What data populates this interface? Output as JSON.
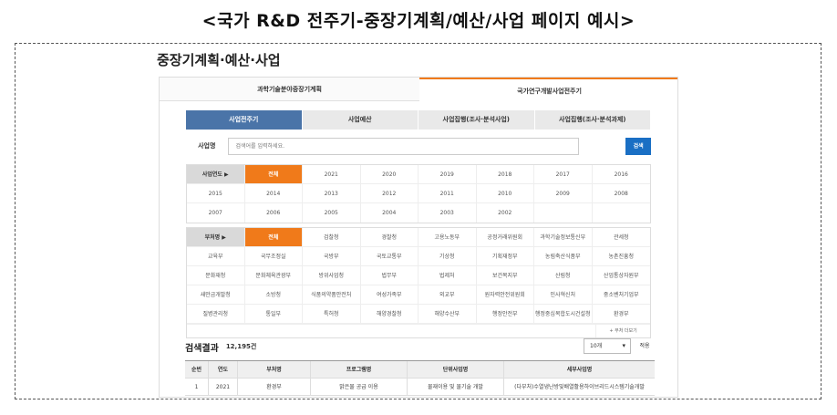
{
  "caption": "<국가 R&D 전주기-중장기계획/예산/사업 페이지 예시>",
  "page_title": "중장기계획·예산·사업",
  "top_tabs": [
    {
      "label": "과학기술분야중장기계획",
      "active": false
    },
    {
      "label": "국가연구개발사업전주기",
      "active": true
    }
  ],
  "sub_tabs": [
    {
      "label": "사업전주기",
      "active": true
    },
    {
      "label": "사업예산",
      "active": false
    },
    {
      "label": "사업집행(조사·분석사업)",
      "active": false
    },
    {
      "label": "사업집행(조사·분석과제)",
      "active": false
    }
  ],
  "search": {
    "label": "사업명",
    "placeholder": "검색어를 입력하세요.",
    "button": "검색"
  },
  "year_filter": {
    "header": "사업연도 ▶",
    "rows": [
      [
        "전체",
        "2021",
        "2020",
        "2019",
        "2018",
        "2017",
        "2016"
      ],
      [
        "2015",
        "2014",
        "2013",
        "2012",
        "2011",
        "2010",
        "2009",
        "2008"
      ],
      [
        "2007",
        "2006",
        "2005",
        "2004",
        "2003",
        "2002",
        "",
        ""
      ]
    ]
  },
  "ministry_filter": {
    "header": "부처명 ▶",
    "rows": [
      [
        "전체",
        "검찰청",
        "경찰청",
        "고용노동부",
        "공정거래위원회",
        "과학기술정보통신부",
        "관세청"
      ],
      [
        "교육부",
        "국무조정실",
        "국방부",
        "국토교통부",
        "기상청",
        "기획재정부",
        "농림축산식품부",
        "농촌진흥청"
      ],
      [
        "문화재청",
        "문화체육관광부",
        "방위사업청",
        "법무부",
        "법제처",
        "보건복지부",
        "산림청",
        "산업통상자원부"
      ],
      [
        "새만금개발청",
        "소방청",
        "식품의약품안전처",
        "여성가족부",
        "외교부",
        "원자력안전위원회",
        "인사혁신처",
        "중소벤처기업부"
      ],
      [
        "질병관리청",
        "통일부",
        "특허청",
        "해양경찰청",
        "해양수산부",
        "행정안전부",
        "행정중심복합도시건설청",
        "환경부"
      ]
    ],
    "more": "+ 부처 더보기"
  },
  "results": {
    "label": "검색결과",
    "count": "12,195건",
    "page_size": "10개",
    "apply": "적용"
  },
  "table": {
    "headers": [
      "순번",
      "연도",
      "부처명",
      "프로그램명",
      "단위사업명",
      "세부사업명"
    ],
    "rows": [
      [
        "1",
        "2021",
        "환경부",
        "맑은물 공급 이용",
        "물재이용 및 물기술 개발",
        "(다부처)수열냉난방및배열활용하이브리드시스템기술개발"
      ]
    ]
  },
  "colors": {
    "accent_orange": "#f07a1a",
    "tab_blue": "#4a74a8",
    "button_blue": "#1a6fc4"
  }
}
